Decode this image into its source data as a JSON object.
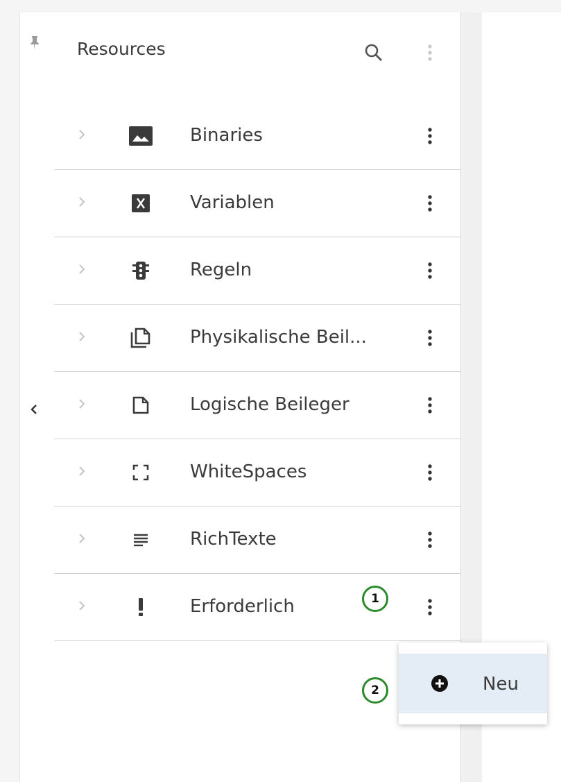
{
  "panel": {
    "title": "Resources",
    "search_icon": "search-icon",
    "menu_icon": "more-vert-icon"
  },
  "rail": {
    "pin_icon": "pin-icon",
    "collapse_icon": "chevron-left-icon"
  },
  "items": [
    {
      "label": "Binaries",
      "icon": "image-icon"
    },
    {
      "label": "Variablen",
      "icon": "variable-icon"
    },
    {
      "label": "Regeln",
      "icon": "traffic-light-icon"
    },
    {
      "label": "Physikalische Beil...",
      "icon": "copy-document-icon"
    },
    {
      "label": "Logische Beileger",
      "icon": "document-icon"
    },
    {
      "label": "WhiteSpaces",
      "icon": "crop-free-icon"
    },
    {
      "label": "RichTexte",
      "icon": "text-lines-icon"
    },
    {
      "label": "Erforderlich",
      "icon": "exclamation-icon"
    }
  ],
  "context_menu": {
    "new_label": "Neu",
    "new_icon": "add-circle-icon"
  },
  "markers": [
    "1",
    "2"
  ],
  "colors": {
    "marker_ring": "#2b8a2b",
    "menu_highlight": "#e4edf5",
    "icon_dark": "#3a3a3a"
  }
}
